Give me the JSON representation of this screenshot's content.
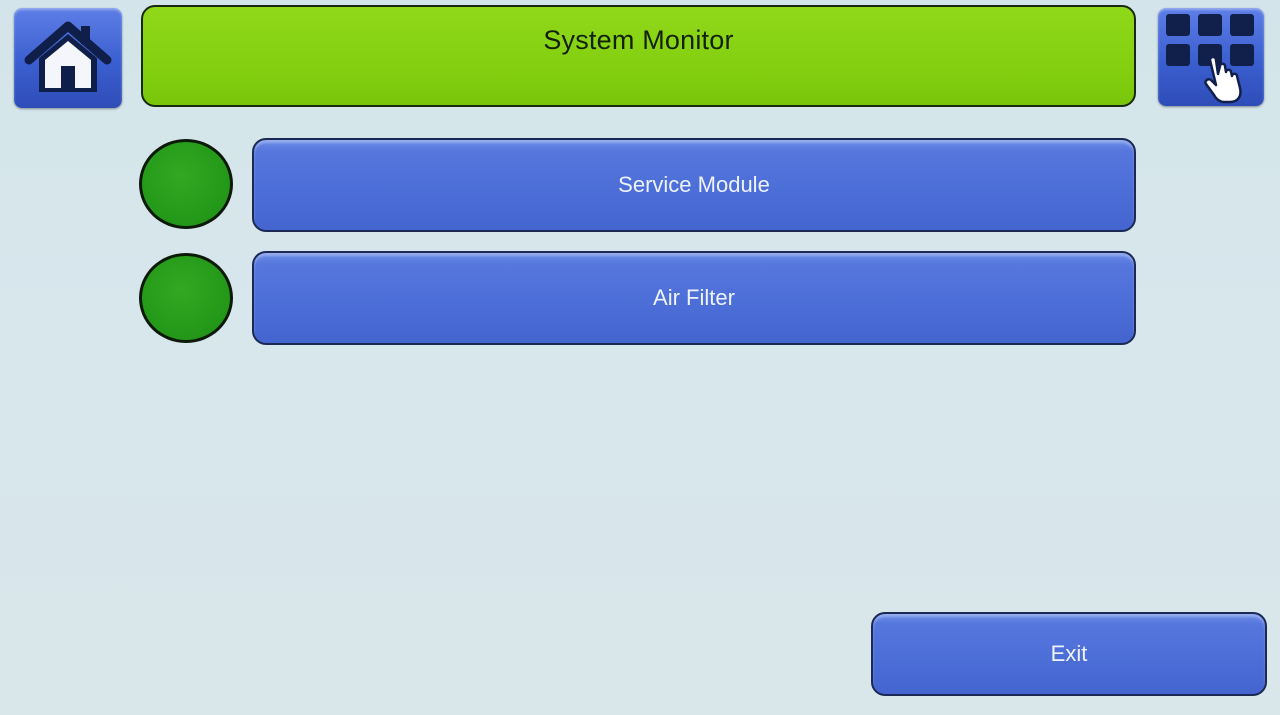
{
  "header": {
    "title": "System Monitor",
    "home_icon": "home-icon",
    "menu_icon": "grid-menu-touch-icon"
  },
  "items": [
    {
      "label": "Service Module",
      "status": "ok",
      "status_color": "#259a1a"
    },
    {
      "label": "Air Filter",
      "status": "ok",
      "status_color": "#259a1a"
    }
  ],
  "footer": {
    "exit_label": "Exit"
  },
  "colors": {
    "title_bar": "#84d010",
    "button_blue": "#4d6fd8",
    "status_green": "#259a1a",
    "background": "#d6e6eb"
  }
}
